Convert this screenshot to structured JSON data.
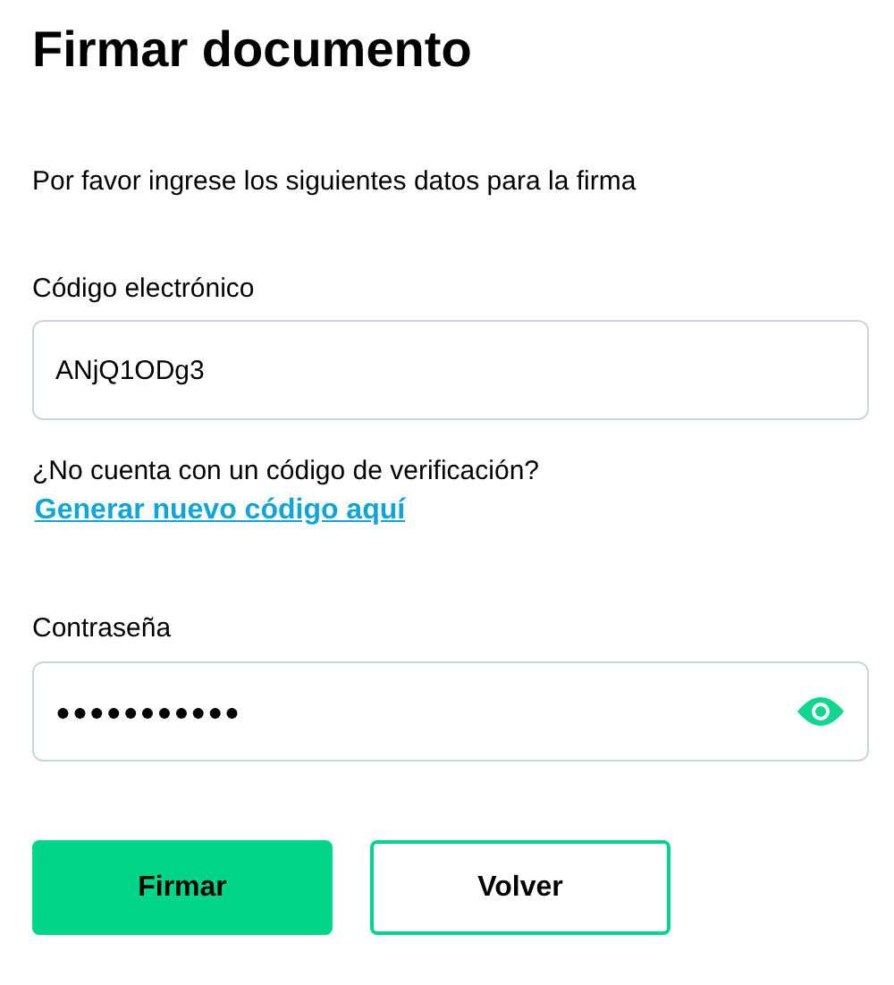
{
  "title": "Firmar documento",
  "intro": "Por favor ingrese los siguientes datos para la firma",
  "code_field": {
    "label": "Código electrónico",
    "value": "ANjQ1ODg3"
  },
  "help": {
    "question": "¿No cuenta con un código de verificación?",
    "link": "Generar nuevo código aquí"
  },
  "password_field": {
    "label": "Contraseña",
    "value": "●●●●●●●●●●●"
  },
  "buttons": [
    {
      "label": "Firmar",
      "kind": "primary"
    },
    {
      "label": "Volver",
      "kind": "secondary"
    }
  ]
}
